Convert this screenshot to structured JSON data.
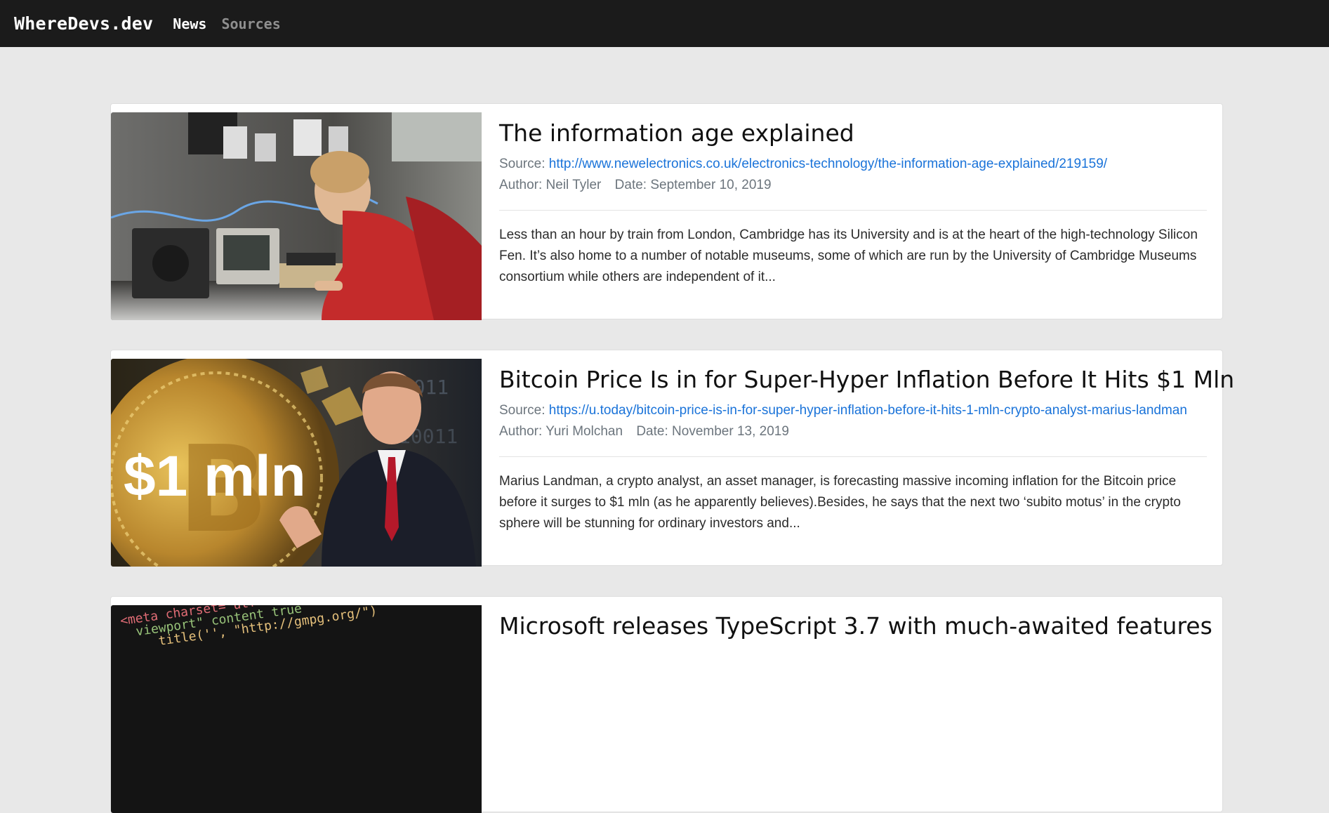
{
  "navbar": {
    "brand": "WhereDevs.dev",
    "links": [
      {
        "label": "News",
        "active": true
      },
      {
        "label": "Sources",
        "active": false
      }
    ]
  },
  "labels": {
    "source": "Source:",
    "author": "Author:",
    "date": "Date:"
  },
  "articles": [
    {
      "title": "The information age explained",
      "source_url": "http://www.newelectronics.co.uk/electronics-technology/the-information-age-explained/219159/",
      "author": "Neil Tyler",
      "date": "September 10, 2019",
      "excerpt": "Less than an hour by train from London, Cambridge has its University and is at the heart of the high-technology Silicon Fen. It’s also home to a number of notable museums, some of which are run by the University of Cambridge Museums consortium while others are independent of it..."
    },
    {
      "title": "Bitcoin Price Is in for Super-Hyper Inflation Before It Hits $1 Mln",
      "source_url": "https://u.today/bitcoin-price-is-in-for-super-hyper-inflation-before-it-hits-1-mln-crypto-analyst-marius-landman",
      "author": "Yuri Molchan",
      "date": "November 13, 2019",
      "excerpt": "Marius Landman, a crypto analyst, an asset manager, is forecasting massive incoming inflation for the Bitcoin price before it surges to $1 mln (as he apparently believes).Besides, he says that the next two ‘subito motus’ in the crypto sphere will be stunning for ordinary investors and...",
      "image_text": "$1 mln"
    },
    {
      "title": "Microsoft releases TypeScript 3.7 with much-awaited features"
    }
  ],
  "colors": {
    "navbar_bg": "#1b1b1b",
    "page_bg": "#e8e8e8",
    "link": "#1a73d9",
    "muted": "#6c757d"
  }
}
